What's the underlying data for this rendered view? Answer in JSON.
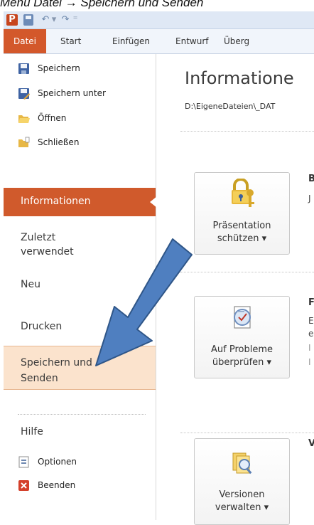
{
  "caption": "Menü Datei → Speichern und Senden",
  "ribbon": {
    "tabs": [
      "Datei",
      "Start",
      "Einfügen",
      "Entwurf",
      "Überg"
    ]
  },
  "sidebar": {
    "speichern": "Speichern",
    "speichern_unter": "Speichern unter",
    "oeffnen": "Öffnen",
    "schliessen": "Schließen",
    "informationen": "Informationen",
    "zuletzt_1": "Zuletzt",
    "zuletzt_2": "verwendet",
    "neu": "Neu",
    "drucken": "Drucken",
    "speichern_senden_1": "Speichern und",
    "speichern_senden_2": "Senden",
    "hilfe": "Hilfe",
    "optionen": "Optionen",
    "beenden": "Beenden"
  },
  "main": {
    "title": "Informatione",
    "path": "D:\\EigeneDateien\\_DAT",
    "buttons": {
      "protect_1": "Präsentation",
      "protect_2": "schützen ▾",
      "check_1": "Auf Probleme",
      "check_2": "überprüfen ▾",
      "versions_1": "Versionen",
      "versions_2": "verwalten ▾"
    },
    "side_letters": {
      "b": "B",
      "j": "J",
      "f": "F",
      "e1": "E",
      "e2": "e",
      "i1": "I",
      "i2": "I",
      "v": "V"
    }
  },
  "colors": {
    "accent": "#d05a2c",
    "arrow": "#4f7fc0"
  }
}
